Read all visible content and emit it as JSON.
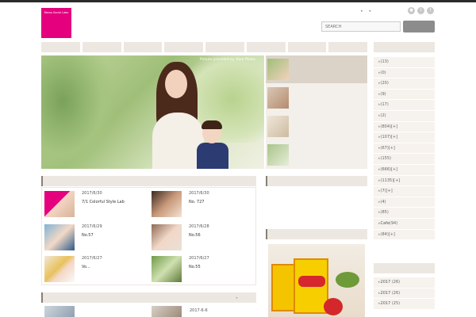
{
  "header": {
    "logo_line1": "",
    "logo_line2": "",
    "logo_sub": "Mama Social Labo",
    "top_links": [
      "",
      ""
    ],
    "social_icons": [
      "rss-icon",
      "twitter-icon",
      "facebook-icon"
    ],
    "search_placeholder": "SEARCH",
    "search_button": ""
  },
  "nav": {
    "items": [
      "",
      "",
      "",
      "",
      "",
      "",
      "",
      ""
    ]
  },
  "hero": {
    "credit": "Picture provided by Yuka Photo.",
    "caption": ""
  },
  "slider_thumbs": [
    {
      "title": ""
    },
    {
      "title": ""
    },
    {
      "title": ""
    },
    {
      "title": ""
    }
  ],
  "new_posts": {
    "heading": "",
    "items": [
      {
        "date": "2017/6/30",
        "title": "7/1 Colorful Style Lab"
      },
      {
        "date": "2017/6/30",
        "title": "No. 727"
      },
      {
        "date": "2017/6/29",
        "title": "No.57"
      },
      {
        "date": "2017/6/28",
        "title": "No.56"
      },
      {
        "date": "2017/6/27",
        "title": "Vo..."
      },
      {
        "date": "2017/6/27",
        "title": "No.55"
      }
    ]
  },
  "second_section": {
    "heading": "",
    "more": "",
    "date": "2017-6-6"
  },
  "about": {
    "heading": "",
    "text": ""
  },
  "photo_section": {
    "heading": ""
  },
  "categories": {
    "heading": "",
    "items": [
      {
        "label": "",
        "count": "(13)"
      },
      {
        "label": "",
        "count": "(0)"
      },
      {
        "label": "",
        "count": "(20)"
      },
      {
        "label": "",
        "count": "(9)"
      },
      {
        "label": "",
        "count": "(17)"
      },
      {
        "label": "",
        "count": "(2)"
      },
      {
        "label": "",
        "count": "(804)[+]"
      },
      {
        "label": "",
        "count": "(107)[+]"
      },
      {
        "label": "",
        "count": "(67)[+]"
      },
      {
        "label": "",
        "count": "(155)"
      },
      {
        "label": "",
        "count": "(666)[+]"
      },
      {
        "label": "",
        "count": "(1135)[+]"
      },
      {
        "label": "",
        "count": "(7)[+]"
      },
      {
        "label": "",
        "count": "(4)"
      },
      {
        "label": "",
        "count": "(85)"
      },
      {
        "label": "Cafe",
        "count": "(94)"
      },
      {
        "label": "",
        "count": "(84)[+]"
      }
    ]
  },
  "archives": {
    "heading": "",
    "items": [
      {
        "label": "2017",
        "count": "(26)"
      },
      {
        "label": "2017",
        "count": "(26)"
      },
      {
        "label": "2017",
        "count": "(25)"
      }
    ]
  },
  "colors": {
    "brand_pink": "#e5007e",
    "nav_bg": "#ede7e1",
    "sidebar_bg": "#f6f2ee"
  }
}
